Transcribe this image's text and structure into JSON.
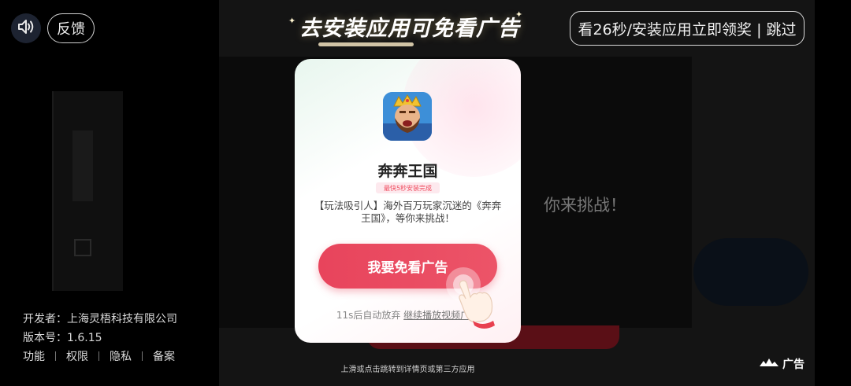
{
  "top": {
    "feedback_label": "反馈",
    "banner_text": "去安装应用可免看广告",
    "skip_label": "看26秒/安装应用立即领奖 | 跳过"
  },
  "popup": {
    "app_name": "奔奔王国",
    "install_tag": "最快5秒安装完成",
    "description": "【玩法吸引人】海外百万玩家沉迷的《奔奔王国》，等你来挑战！",
    "cta_label": "我要免看广告",
    "auto_text": "11s后自动放弃",
    "continue_link": "继续播放视频广告"
  },
  "background": {
    "title_fragment": "你来挑战！"
  },
  "app_info": {
    "developer": "开发者：上海灵梧科技有限公司",
    "version": "版本号：1.6.15",
    "links": [
      "功能",
      "权限",
      "隐私",
      "备案"
    ]
  },
  "footer": {
    "hint": "上滑或点击跳转到详情页或第三方应用",
    "ad_label": "广告"
  },
  "colors": {
    "accent": "#e8445c",
    "tag_bg": "#fde9ee"
  },
  "icons": [
    "speaker-icon",
    "app-icon",
    "hand-pointer-icon",
    "ad-logo-icon"
  ]
}
